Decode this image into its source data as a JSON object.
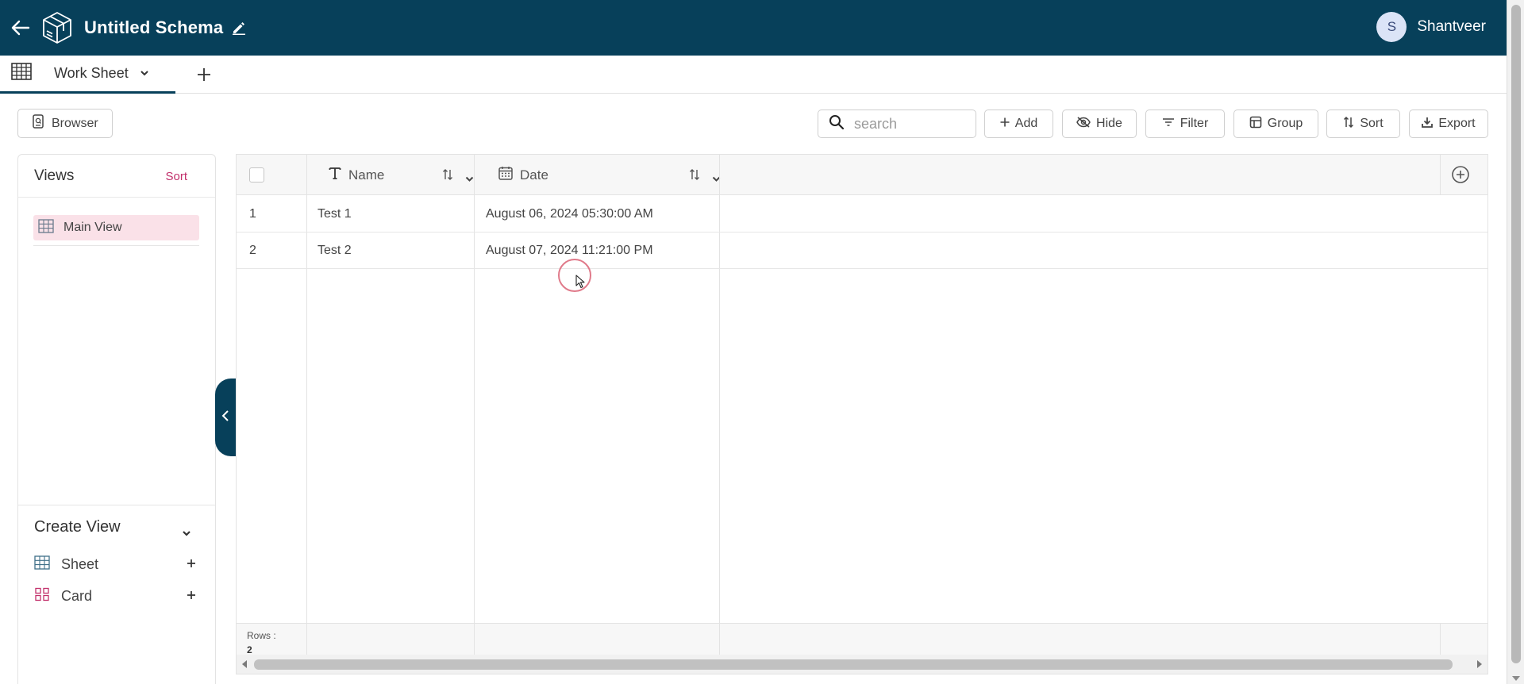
{
  "header": {
    "schema_title": "Untitled Schema",
    "user": {
      "initial": "S",
      "name": "Shantveer"
    }
  },
  "tabs": [
    {
      "label": "Work Sheet",
      "active": true
    }
  ],
  "toolbar": {
    "browser_label": "Browser",
    "search_placeholder": "search",
    "add_label": "Add",
    "hide_label": "Hide",
    "filter_label": "Filter",
    "group_label": "Group",
    "sort_label": "Sort",
    "export_label": "Export"
  },
  "views": {
    "title": "Views",
    "sort_label": "Sort",
    "items": [
      {
        "label": "Main View",
        "selected": true
      }
    ]
  },
  "create_view": {
    "title": "Create View",
    "options": [
      {
        "label": "Sheet"
      },
      {
        "label": "Card"
      }
    ]
  },
  "grid": {
    "columns": [
      {
        "label": "Name",
        "type_icon": "text-type-icon"
      },
      {
        "label": "Date",
        "type_icon": "calendar-icon"
      }
    ],
    "rows": [
      {
        "index": "1",
        "name": "Test 1",
        "date": "August 06, 2024 05:30:00 AM"
      },
      {
        "index": "2",
        "name": "Test 2",
        "date": "August 07, 2024 11:21:00 PM"
      }
    ],
    "footer": {
      "rows_label": "Rows :",
      "rows_count": "2"
    }
  },
  "colors": {
    "header_bg": "#07405a",
    "accent_pink": "#c2306b",
    "selected_view_bg": "#fae1e8"
  }
}
